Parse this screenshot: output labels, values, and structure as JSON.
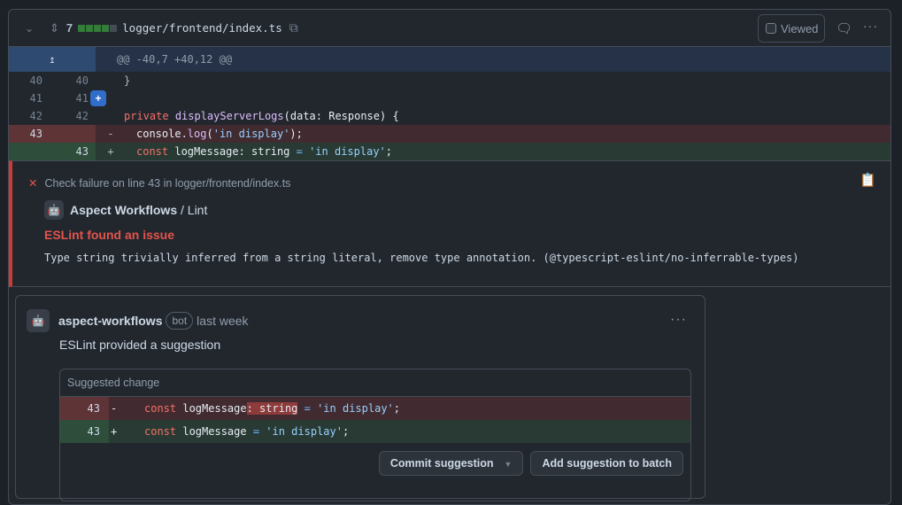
{
  "file": {
    "change_count": "7",
    "path": "logger/frontend/index.ts",
    "viewed_label": "Viewed",
    "hunk": "@@ -40,7 +40,12 @@"
  },
  "lines": [
    {
      "old": "40",
      "new": "40",
      "sign": "",
      "code": "}"
    },
    {
      "old": "41",
      "new": "41",
      "sign": "",
      "code": ""
    },
    {
      "old": "42",
      "new": "42",
      "sign": "",
      "kw": "private",
      "fn": "displayServerLogs",
      "rest": "(data: Response) {"
    },
    {
      "old": "43",
      "new": "",
      "sign": "-",
      "a": "console.",
      "fn": "log",
      "b": "(",
      "st": "'in display'",
      "c": ");"
    },
    {
      "old": "",
      "new": "43",
      "sign": "+",
      "kw": "const",
      "a": " logMessage: string ",
      "op": "=",
      "st": " 'in display'",
      "c": ";"
    }
  ],
  "check": {
    "title": "Check failure on line 43 in logger/frontend/index.ts",
    "app": "Aspect Workflows",
    "sep": " / ",
    "name": "Lint",
    "heading": "ESLint found an issue",
    "message": "Type string trivially inferred from a string literal, remove type annotation. (@typescript-eslint/no-inferrable-types)"
  },
  "comment": {
    "author": "aspect-workflows",
    "badge": "bot",
    "time": "last week",
    "body": "ESLint provided a suggestion",
    "suggestion": {
      "title": "Suggested change",
      "del": {
        "num": "43",
        "sign": "-",
        "kw": "const",
        "a": " logMessage",
        "hl": ": string",
        "op": " =",
        "st": " 'in display'",
        "c": ";"
      },
      "add": {
        "num": "43",
        "sign": "+",
        "kw": "const",
        "a": " logMessage",
        "op": " =",
        "st": " 'in display'",
        "c": ";"
      },
      "commit_label": "Commit suggestion",
      "batch_label": "Add suggestion to batch"
    }
  }
}
